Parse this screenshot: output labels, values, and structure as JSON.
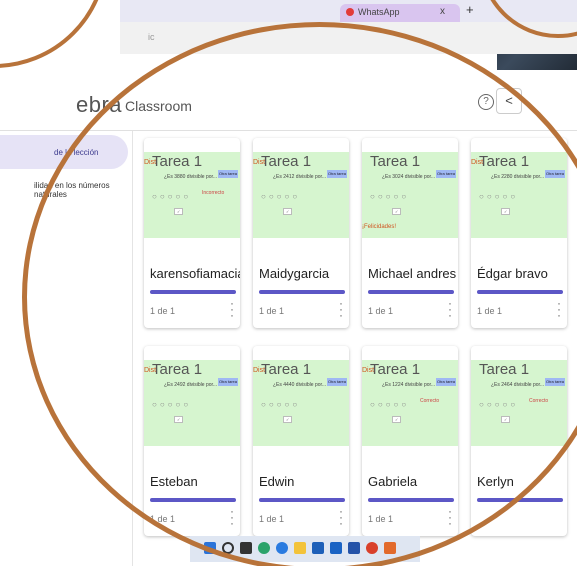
{
  "browser": {
    "tab_title": "WhatsApp",
    "tab_close": "x",
    "new_tab": "+",
    "address_fragment": "ic"
  },
  "app": {
    "brand": "ebra",
    "section": "Classroom",
    "help_icon": "?",
    "share_icon": "<"
  },
  "sidebar": {
    "items": [
      {
        "label": "de la lección",
        "active": true
      },
      {
        "label": "ilidad en los números naturales",
        "active": false
      }
    ]
  },
  "cards": [
    {
      "prefix": "Dist",
      "title": "Tarea 1",
      "name": "karensofiamaciascla...",
      "count": "1 de 1",
      "desc": "¿Es 3880 divisible por...",
      "btn": "Otra tarea",
      "note": "Incorrecto",
      "note2": ""
    },
    {
      "prefix": "Dist",
      "title": "Tarea 1",
      "name": "Maidygarcia",
      "count": "1 de 1",
      "desc": "¿Es 2412 divisible por...",
      "btn": "Otra tarea",
      "note": "",
      "note2": ""
    },
    {
      "prefix": "",
      "title": "Tarea 1",
      "name": "Michael andres quis...",
      "count": "1 de 1",
      "desc": "¿Es 3024 divisible por...",
      "btn": "Otra tarea",
      "note": "",
      "note2": "¡Felicidades!"
    },
    {
      "prefix": "Dist",
      "title": "Tarea 1",
      "name": "Édgar bravo",
      "count": "1 de 1",
      "desc": "¿Es 2280 divisible por...",
      "btn": "Otra tarea",
      "note": "",
      "note2": ""
    },
    {
      "prefix": "Dist",
      "title": "Tarea 1",
      "name": "Esteban",
      "count": "1 de 1",
      "desc": "¿Es 2492 divisible por...",
      "btn": "Otra tarea",
      "note": "",
      "note2": ""
    },
    {
      "prefix": "Dist",
      "title": "Tarea 1",
      "name": "Edwin",
      "count": "1 de 1",
      "desc": "¿Es 4440 divisible por...",
      "btn": "Otra tarea",
      "note": "",
      "note2": ""
    },
    {
      "prefix": "Dist",
      "title": "Tarea 1",
      "name": "Gabriela",
      "count": "1 de 1",
      "desc": "¿Es 1224 divisible por...",
      "btn": "Otra tarea",
      "note": "Correcto",
      "note2": ""
    },
    {
      "prefix": "",
      "title": "Tarea 1",
      "name": "Kerlyn",
      "count": "",
      "desc": "¿Es 2464 divisible por...",
      "btn": "Otra tarea",
      "note": "Correcto",
      "note2": ""
    }
  ],
  "colors": {
    "frame": "#b8733a",
    "thumb_bg": "#d6f5cf",
    "progress": "#5c57c6",
    "sidebar_active": "#e6e3f6"
  }
}
